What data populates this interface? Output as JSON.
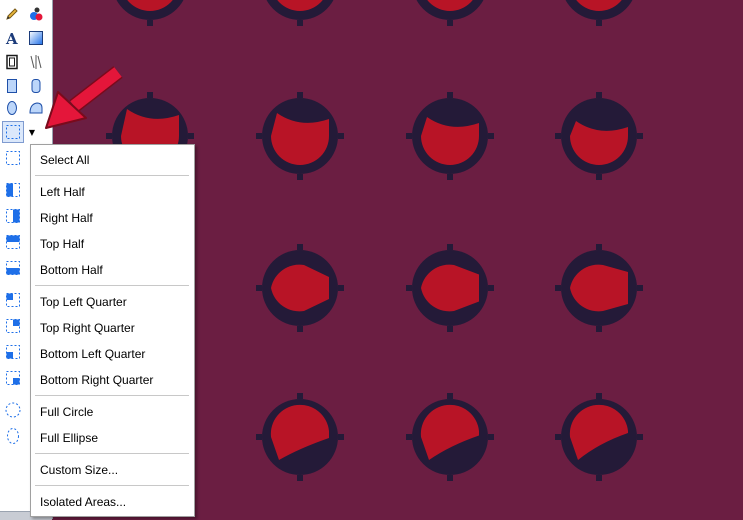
{
  "colors": {
    "canvas_bg": "#6b1e42",
    "sprite_dark": "#241a38",
    "sprite_red": "#b81426",
    "annotation_arrow": "#e4163a",
    "selection_blue": "#1e6fe8"
  },
  "toolbox": {
    "tools": [
      "pencil-icon",
      "color-picker-icon",
      "text-icon",
      "gradient-icon",
      "frame-icon",
      "mirror-icon",
      "rectangle-icon",
      "rounded-rectangle-icon",
      "ellipse-icon",
      "fill-shape-icon",
      "rectangle-select-icon"
    ]
  },
  "selection_menu": {
    "items": [
      {
        "label": "Select All"
      },
      {
        "label": "Left Half"
      },
      {
        "label": "Right Half"
      },
      {
        "label": "Top Half"
      },
      {
        "label": "Bottom Half"
      },
      {
        "label": "Top Left Quarter"
      },
      {
        "label": "Top Right Quarter"
      },
      {
        "label": "Bottom Left Quarter"
      },
      {
        "label": "Bottom Right Quarter"
      },
      {
        "label": "Full Circle"
      },
      {
        "label": "Full Ellipse"
      },
      {
        "label": "Custom Size..."
      },
      {
        "label": "Isolated Areas..."
      }
    ]
  }
}
